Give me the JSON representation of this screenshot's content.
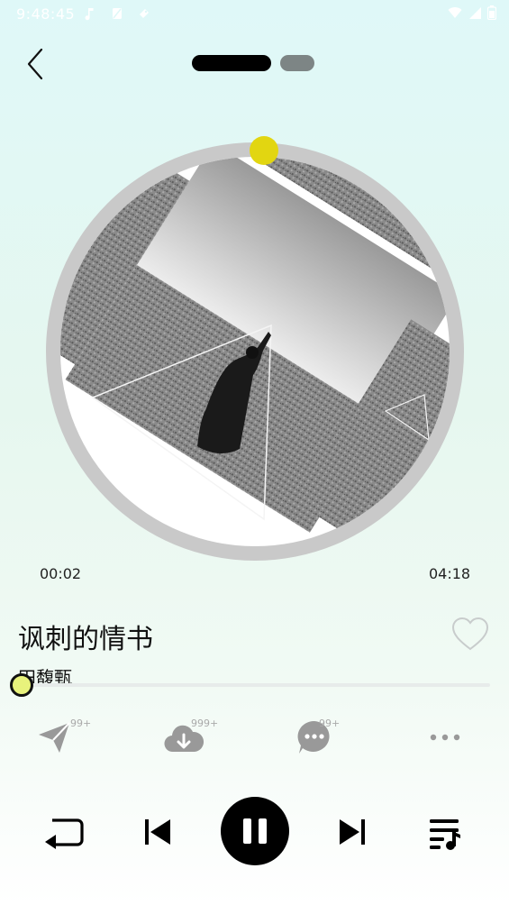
{
  "status_bar": {
    "time": "9:48:45",
    "left_icons": [
      "music-note-icon",
      "sim-off-icon",
      "app-icon"
    ],
    "right_icons": [
      "wifi-icon",
      "signal-icon",
      "battery-icon"
    ]
  },
  "header": {
    "back_icon": "chevron-left-icon",
    "pages": [
      {
        "name": "page-1",
        "active": true
      },
      {
        "name": "page-2",
        "active": false
      }
    ]
  },
  "player": {
    "current_time": "00:02",
    "total_time": "04:18",
    "progress_fraction": 0.008,
    "disc_progress_fraction": 0.008
  },
  "song": {
    "title": "讽刺的情书",
    "artist": "田馥甄",
    "liked": false
  },
  "actions": [
    {
      "name": "share",
      "icon": "paper-plane-icon",
      "badge": "99+"
    },
    {
      "name": "download",
      "icon": "cloud-download-icon",
      "badge": "999+"
    },
    {
      "name": "comment",
      "icon": "comment-bubble-icon",
      "badge": "99+"
    },
    {
      "name": "more",
      "icon": "more-dots-icon",
      "badge": ""
    }
  ],
  "controls": [
    {
      "name": "repeat",
      "icon": "repeat-icon"
    },
    {
      "name": "previous",
      "icon": "skip-previous-icon"
    },
    {
      "name": "play-pause",
      "icon": "pause-icon"
    },
    {
      "name": "next",
      "icon": "skip-next-icon"
    },
    {
      "name": "playlist",
      "icon": "playlist-icon"
    }
  ],
  "colors": {
    "thumb_disc": "#e2d611",
    "thumb_progress": "#e8f27c",
    "accent": "#000000",
    "badge": "#aaaaaa"
  }
}
